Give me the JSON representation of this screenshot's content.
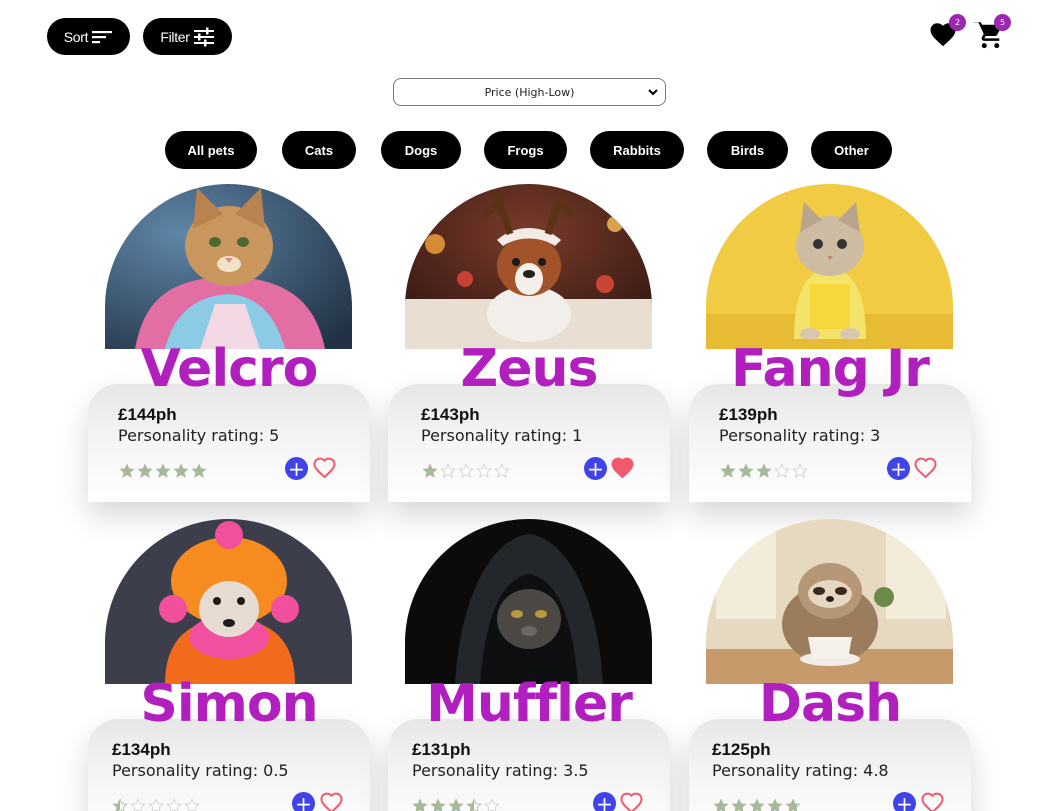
{
  "toolbar": {
    "sort_label": "Sort",
    "filter_label": "Filter"
  },
  "header": {
    "wishlist_count": "2",
    "cart_count": "5"
  },
  "sort_select": {
    "selected": "Price (High-Low)"
  },
  "categories": [
    "All pets",
    "Cats",
    "Dogs",
    "Frogs",
    "Rabbits",
    "Birds",
    "Other"
  ],
  "colors": {
    "accent": "#b21fbf",
    "add_button": "#3f43e8",
    "heart": "#ef5a6f",
    "badge": "#9c27b0",
    "star": "#a8b89a"
  },
  "pets": [
    {
      "name": "Velcro",
      "price": "£144ph",
      "rating_text": "Personality rating: 5",
      "rating": 5,
      "favourited": false
    },
    {
      "name": "Zeus",
      "price": "£143ph",
      "rating_text": "Personality rating: 1",
      "rating": 1,
      "favourited": true
    },
    {
      "name": "Fang Jr",
      "price": "£139ph",
      "rating_text": "Personality rating: 3",
      "rating": 3,
      "favourited": false
    },
    {
      "name": "Simon",
      "price": "£134ph",
      "rating_text": "Personality rating: 0.5",
      "rating": 0.5,
      "favourited": false
    },
    {
      "name": "Muffler",
      "price": "£131ph",
      "rating_text": "Personality rating: 3.5",
      "rating": 3.5,
      "favourited": false
    },
    {
      "name": "Dash",
      "price": "£125ph",
      "rating_text": "Personality rating: 4.8",
      "rating": 4.8,
      "favourited": false
    }
  ]
}
